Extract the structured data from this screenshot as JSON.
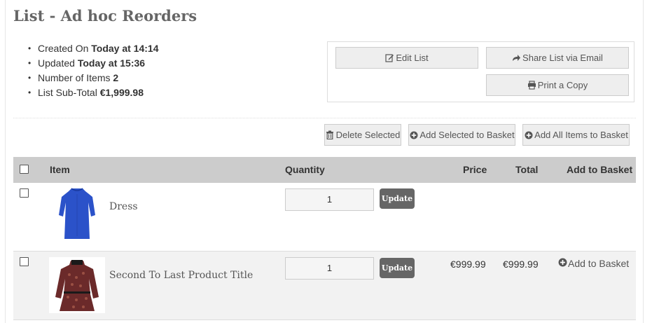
{
  "page": {
    "title": "List - Ad hoc Reorders"
  },
  "meta": [
    {
      "label": "Created On ",
      "value": "Today at 14:14"
    },
    {
      "label": "Updated ",
      "value": "Today at 15:36"
    },
    {
      "label": "Number of Items ",
      "value": "2"
    },
    {
      "label": "List Sub-Total ",
      "value": "€1,999.98"
    }
  ],
  "actions": {
    "edit_label": "Edit List",
    "share_label": "Share List via Email",
    "print_label": "Print a Copy"
  },
  "toolbar": {
    "delete_label": "Delete Selected",
    "add_selected_label": "Add Selected to Basket",
    "add_all_label": "Add All Items to Basket"
  },
  "table": {
    "headers": {
      "item": "Item",
      "quantity": "Quantity",
      "price": "Price",
      "total": "Total",
      "add": "Add to Basket"
    },
    "rows": [
      {
        "name": "Dress",
        "quantity": "1",
        "update_label": "Update",
        "price": "",
        "total": "",
        "add_label": ""
      },
      {
        "name": "Second To Last Product Title",
        "quantity": "1",
        "update_label": "Update",
        "price": "€999.99",
        "total": "€999.99",
        "add_label": "Add to Basket"
      }
    ]
  },
  "colors": {
    "header_bg": "#cccccc",
    "button_bg": "#eeeeee",
    "update_bg": "#666666",
    "dress_blue": "#2b52c9",
    "blouse_maroon": "#6b2a2a"
  },
  "icons": {
    "edit": "edit-icon",
    "share": "share-arrow-icon",
    "print": "print-icon",
    "delete": "trash-icon",
    "add": "plus-circle-icon"
  }
}
